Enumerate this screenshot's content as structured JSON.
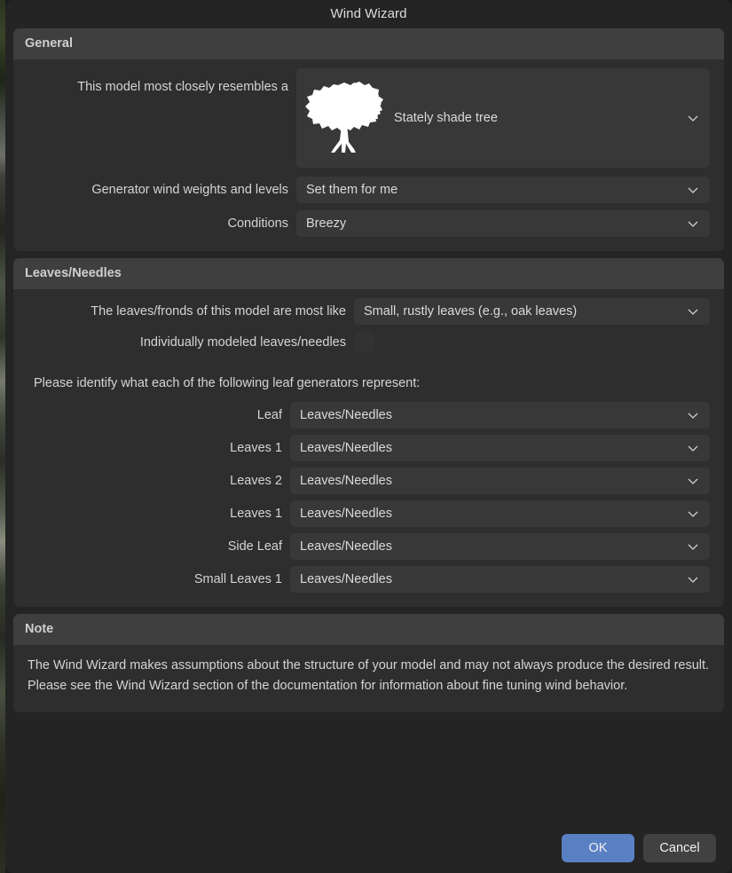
{
  "window": {
    "title": "Wind Wizard"
  },
  "colors": {
    "dialog_bg": "#242424",
    "panel_bg": "#2e2e2e",
    "group_header_bg": "#3f3f3f",
    "combo_bg": "#383838",
    "text": "#d4d4d4",
    "ok_button_bg": "#5a80c4",
    "cancel_button_bg": "#414141"
  },
  "general": {
    "header": "General",
    "model_resembles": {
      "label": "This model most closely resembles a",
      "value": "Stately shade tree",
      "icon": "tree-silhouette-icon",
      "chevron": "chevron-down-icon"
    },
    "wind_weights": {
      "label": "Generator wind weights and levels",
      "value": "Set them for me",
      "chevron": "chevron-down-icon"
    },
    "conditions": {
      "label": "Conditions",
      "value": "Breezy",
      "chevron": "chevron-down-icon"
    }
  },
  "leaves": {
    "header": "Leaves/Needles",
    "leaf_kind": {
      "label": "The leaves/fronds of this model are most like",
      "value": "Small, rustly leaves (e.g., oak leaves)",
      "chevron": "chevron-down-icon"
    },
    "individually_modeled": {
      "label": "Individually modeled leaves/needles",
      "checked": false
    },
    "prompt": "Please identify what each of the following leaf generators represent:",
    "generators": [
      {
        "label": "Leaf",
        "value": "Leaves/Needles",
        "chevron": "chevron-down-icon"
      },
      {
        "label": "Leaves 1",
        "value": "Leaves/Needles",
        "chevron": "chevron-down-icon"
      },
      {
        "label": "Leaves 2",
        "value": "Leaves/Needles",
        "chevron": "chevron-down-icon"
      },
      {
        "label": "Leaves 1",
        "value": "Leaves/Needles",
        "chevron": "chevron-down-icon"
      },
      {
        "label": "Side Leaf",
        "value": "Leaves/Needles",
        "chevron": "chevron-down-icon"
      },
      {
        "label": "Small Leaves 1",
        "value": "Leaves/Needles",
        "chevron": "chevron-down-icon"
      }
    ]
  },
  "note": {
    "header": "Note",
    "text": "The Wind Wizard makes assumptions about the structure of your model and may not always produce the desired result.  Please see the Wind Wizard section of the documentation for information about fine tuning wind behavior."
  },
  "footer": {
    "ok_label": "OK",
    "cancel_label": "Cancel"
  }
}
